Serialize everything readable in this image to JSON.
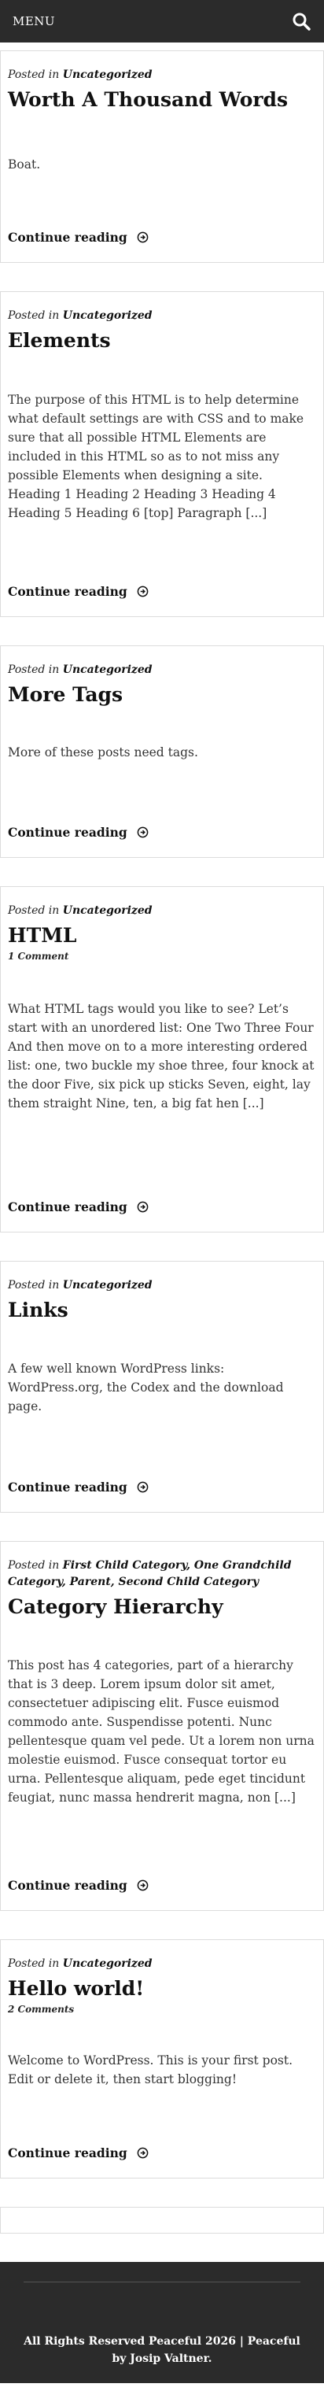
{
  "header": {
    "menu_label": "MENU",
    "search_icon": "search-icon"
  },
  "posts": [
    {
      "meta_prefix": "Posted in",
      "categories_text": "Uncategorized",
      "title": "Worth A Thousand Words",
      "comments": "",
      "excerpt": "Boat.",
      "continue_label": "Continue reading"
    },
    {
      "meta_prefix": "Posted in",
      "categories_text": "Uncategorized",
      "title": "Elements",
      "comments": "",
      "excerpt": "The purpose of this HTML is to help determine what default settings are with CSS and to make sure that all possible HTML Elements are included in this HTML so as to not miss any possible Elements when designing a site. Heading 1 Heading 2 Heading 3 Heading 4 Heading 5 Heading 6 [top] Paragraph [...]",
      "continue_label": "Continue reading"
    },
    {
      "meta_prefix": "Posted in",
      "categories_text": "Uncategorized",
      "title": "More Tags",
      "comments": "",
      "excerpt": "More of these posts need tags.",
      "continue_label": "Continue reading"
    },
    {
      "meta_prefix": "Posted in",
      "categories_text": "Uncategorized",
      "title": "HTML",
      "comments": "1 Comment",
      "excerpt": "What HTML tags would you like to see? Let’s start with an unordered list: One Two Three Four And then move on to a more interesting ordered list: one, two buckle my shoe three, four knock at the door Five, six pick up sticks Seven, eight, lay them straight Nine, ten, a big fat hen [...]",
      "continue_label": "Continue reading"
    },
    {
      "meta_prefix": "Posted in",
      "categories_text": "Uncategorized",
      "title": "Links",
      "comments": "",
      "excerpt": "A few well known WordPress links: WordPress.org, the Codex and the download page.",
      "continue_label": "Continue reading"
    },
    {
      "meta_prefix": "Posted in",
      "categories_text": "First Child Category, One Grandchild Category, Parent, Second Child Category",
      "title": "Category Hierarchy",
      "comments": "",
      "excerpt": "This post has 4 categories, part of a hierarchy that is 3 deep. Lorem ipsum dolor sit amet, consectetuer adipiscing elit. Fusce euismod commodo ante. Suspendisse potenti. Nunc pellentesque quam vel pede. Ut a lorem non urna molestie euismod. Fusce consequat tortor eu urna. Pellentesque aliquam, pede eget tincidunt feugiat, nunc massa hendrerit magna, non [...]",
      "continue_label": "Continue reading"
    },
    {
      "meta_prefix": "Posted in",
      "categories_text": "Uncategorized",
      "title": "Hello world!",
      "comments": "2 Comments",
      "excerpt": "Welcome to WordPress. This is your first post. Edit or delete it, then start blogging!",
      "continue_label": "Continue reading"
    }
  ],
  "footer": {
    "copyright": "All Rights Reserved Peaceful 2026 | Peaceful by Josip Valtner."
  }
}
